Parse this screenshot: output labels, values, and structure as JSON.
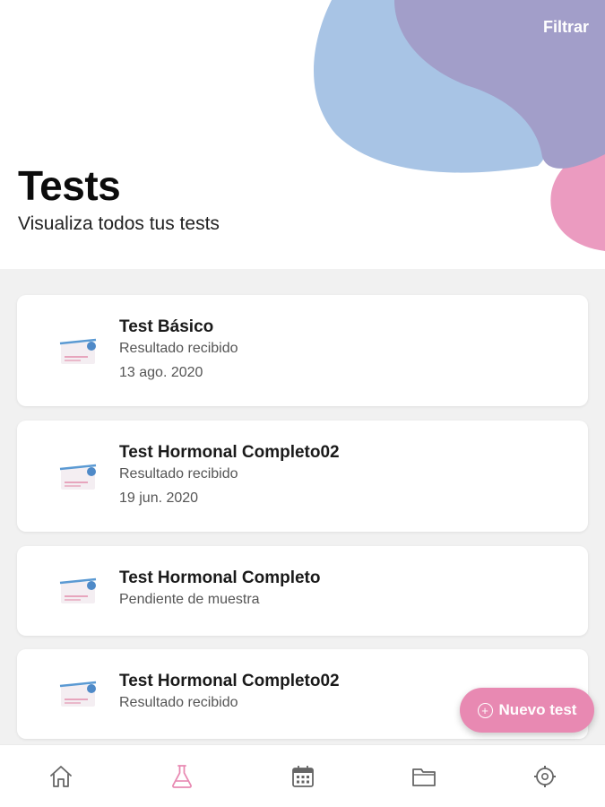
{
  "header": {
    "filter_label": "Filtrar",
    "title": "Tests",
    "subtitle": "Visualiza todos tus tests"
  },
  "tests": [
    {
      "name": "Test Básico",
      "status": "Resultado recibido",
      "date": "13 ago. 2020"
    },
    {
      "name": "Test Hormonal Completo02",
      "status": "Resultado recibido",
      "date": "19 jun. 2020"
    },
    {
      "name": "Test Hormonal Completo",
      "status": "Pendiente de muestra"
    },
    {
      "name": "Test Hormonal Completo02",
      "status": "Resultado recibido"
    }
  ],
  "fab": {
    "label": "Nuevo test",
    "icon": "plus-circle-icon"
  },
  "nav": [
    {
      "icon": "home-icon",
      "active": false
    },
    {
      "icon": "flask-icon",
      "active": true
    },
    {
      "icon": "calendar-icon",
      "active": false
    },
    {
      "icon": "folder-icon",
      "active": false
    },
    {
      "icon": "settings-icon",
      "active": false
    }
  ],
  "colors": {
    "accent_pink": "#e889b2",
    "blob_blue": "#a8c4e5",
    "blob_purple": "#a29ec9",
    "blob_pink": "#eb9bc0",
    "content_bg": "#f1f1f1",
    "nav_inactive": "#666666"
  }
}
